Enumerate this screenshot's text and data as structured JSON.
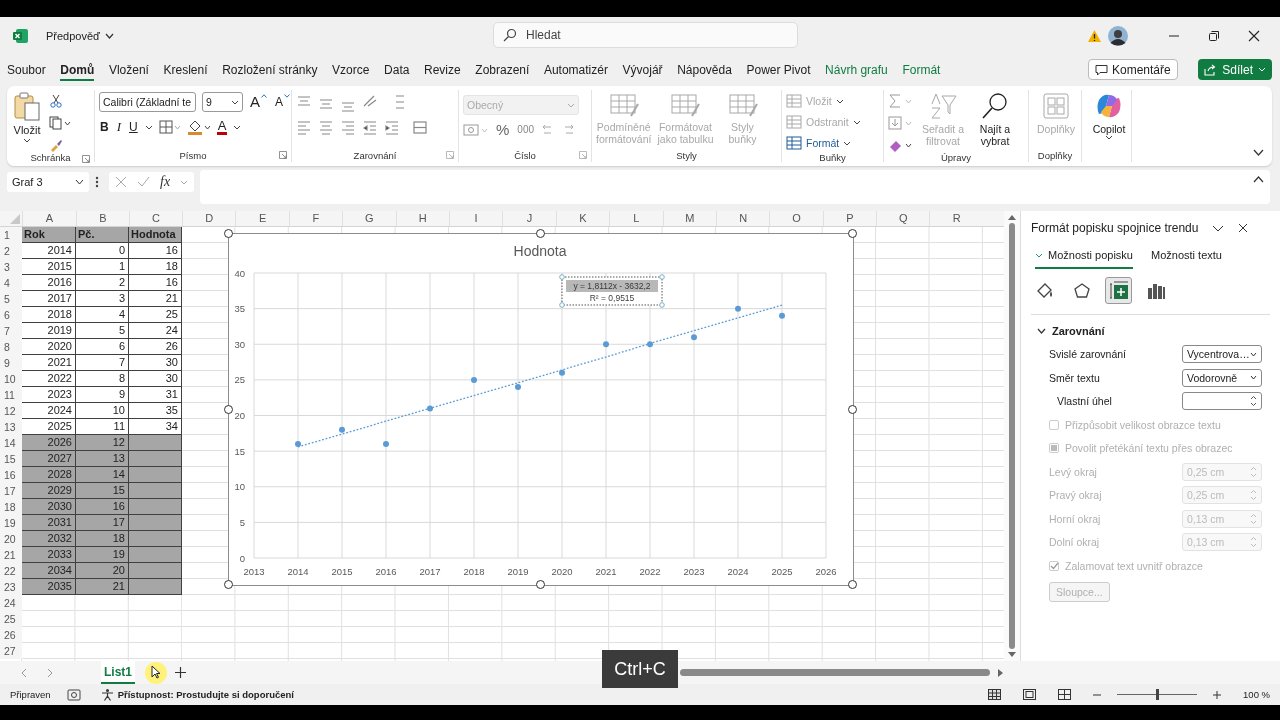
{
  "title_bar": {
    "file_name": "Předpověď",
    "search": {
      "placeholder": "Hledat"
    }
  },
  "menu_tabs": [
    {
      "label": "Soubor",
      "selected": false,
      "kind": "plain"
    },
    {
      "label": "Domů",
      "selected": true,
      "kind": "plain"
    },
    {
      "label": "Vložení",
      "selected": false,
      "kind": "plain"
    },
    {
      "label": "Kreslení",
      "selected": false,
      "kind": "plain"
    },
    {
      "label": "Rozložení stránky",
      "selected": false,
      "kind": "plain"
    },
    {
      "label": "Vzorce",
      "selected": false,
      "kind": "plain"
    },
    {
      "label": "Data",
      "selected": false,
      "kind": "plain"
    },
    {
      "label": "Revize",
      "selected": false,
      "kind": "plain"
    },
    {
      "label": "Zobrazení",
      "selected": false,
      "kind": "plain"
    },
    {
      "label": "Automatizér",
      "selected": false,
      "kind": "plain"
    },
    {
      "label": "Vývojář",
      "selected": false,
      "kind": "plain"
    },
    {
      "label": "Nápověda",
      "selected": false,
      "kind": "plain"
    },
    {
      "label": "Power Pivot",
      "selected": false,
      "kind": "plain"
    },
    {
      "label": "Návrh grafu",
      "selected": false,
      "kind": "context"
    },
    {
      "label": "Formát",
      "selected": false,
      "kind": "context"
    }
  ],
  "actions": {
    "comments": "Komentáře",
    "share": "Sdílet"
  },
  "ribbon": {
    "clipboard": {
      "label": "Schránka",
      "paste": "Vložit"
    },
    "font": {
      "label": "Písmo",
      "font": "Calibri (Základní te",
      "size": "9",
      "grow": "A",
      "shrink": "A",
      "bold": "B",
      "italic": "I",
      "underline": "U",
      "font_color_label": "A"
    },
    "alignment": {
      "label": "Zarovnání"
    },
    "number": {
      "label": "Číslo",
      "format": "Obecný",
      "percent": "%",
      "thousands": "000"
    },
    "styles": {
      "label": "Styly",
      "buttons": [
        {
          "lines": [
            "Podmíněné",
            "formátování"
          ],
          "disabled": true
        },
        {
          "lines": [
            "Formátovat",
            "jako tabulku"
          ],
          "disabled": true
        },
        {
          "lines": [
            "Styly",
            "buňky"
          ],
          "disabled": true
        }
      ]
    },
    "cells": {
      "label": "Buňky",
      "buttons": [
        {
          "label": "Vložit",
          "disabled": true
        },
        {
          "label": "Odstranit",
          "disabled": true
        },
        {
          "label": "Formát",
          "disabled": false
        }
      ]
    },
    "editing": {
      "label": "Úpravy",
      "sort": {
        "lines": [
          "Seřadit a",
          "filtrovat"
        ],
        "disabled": true
      },
      "find": {
        "lines": [
          "Najít a",
          "vybrat"
        ],
        "disabled": false
      }
    },
    "addins": {
      "label": "Doplňky",
      "button": {
        "label": "Doplňky",
        "disabled": true
      }
    },
    "copilot": {
      "label": "Copilot"
    }
  },
  "formula_bar": {
    "name_box": "Graf 3",
    "function_label": "fx"
  },
  "sheet": {
    "columns": [
      "A",
      "B",
      "C",
      "D",
      "E",
      "F",
      "G",
      "H",
      "I",
      "J",
      "K",
      "L",
      "M",
      "N",
      "O",
      "P",
      "Q",
      "R"
    ],
    "rows": [
      {
        "number": "1",
        "kind": "header",
        "cells": [
          "Rok",
          "Pč.",
          "Hodnota"
        ]
      },
      {
        "number": "2",
        "kind": "data",
        "cells": [
          "2014",
          "0",
          "16"
        ]
      },
      {
        "number": "3",
        "kind": "data",
        "cells": [
          "2015",
          "1",
          "18"
        ]
      },
      {
        "number": "4",
        "kind": "data",
        "cells": [
          "2016",
          "2",
          "16"
        ]
      },
      {
        "number": "5",
        "kind": "data",
        "cells": [
          "2017",
          "3",
          "21"
        ]
      },
      {
        "number": "6",
        "kind": "data",
        "cells": [
          "2018",
          "4",
          "25"
        ]
      },
      {
        "number": "7",
        "kind": "data",
        "cells": [
          "2019",
          "5",
          "24"
        ]
      },
      {
        "number": "8",
        "kind": "data",
        "cells": [
          "2020",
          "6",
          "26"
        ]
      },
      {
        "number": "9",
        "kind": "data",
        "cells": [
          "2021",
          "7",
          "30"
        ]
      },
      {
        "number": "10",
        "kind": "data",
        "cells": [
          "2022",
          "8",
          "30"
        ]
      },
      {
        "number": "11",
        "kind": "data",
        "cells": [
          "2023",
          "9",
          "31"
        ]
      },
      {
        "number": "12",
        "kind": "data",
        "cells": [
          "2024",
          "10",
          "35"
        ]
      },
      {
        "number": "13",
        "kind": "data",
        "cells": [
          "2025",
          "11",
          "34"
        ]
      },
      {
        "number": "14",
        "kind": "forecast",
        "cells": [
          "2026",
          "12"
        ]
      },
      {
        "number": "15",
        "kind": "forecast",
        "cells": [
          "2027",
          "13"
        ]
      },
      {
        "number": "16",
        "kind": "forecast",
        "cells": [
          "2028",
          "14"
        ]
      },
      {
        "number": "17",
        "kind": "forecast",
        "cells": [
          "2029",
          "15"
        ]
      },
      {
        "number": "18",
        "kind": "forecast",
        "cells": [
          "2030",
          "16"
        ]
      },
      {
        "number": "19",
        "kind": "forecast",
        "cells": [
          "2031",
          "17"
        ]
      },
      {
        "number": "20",
        "kind": "forecast",
        "cells": [
          "2032",
          "18"
        ]
      },
      {
        "number": "21",
        "kind": "forecast",
        "cells": [
          "2033",
          "19"
        ]
      },
      {
        "number": "22",
        "kind": "forecast",
        "cells": [
          "2034",
          "20"
        ]
      },
      {
        "number": "23",
        "kind": "forecast",
        "cells": [
          "2035",
          "21"
        ]
      },
      {
        "number": "24",
        "kind": "empty"
      },
      {
        "number": "25",
        "kind": "empty"
      },
      {
        "number": "26",
        "kind": "empty"
      },
      {
        "number": "27",
        "kind": "empty"
      }
    ]
  },
  "chart": {
    "chart_data": {
      "type": "scatter",
      "title": "Hodnota",
      "x": [
        2014,
        2015,
        2016,
        2017,
        2018,
        2019,
        2020,
        2021,
        2022,
        2023,
        2024,
        2025
      ],
      "series": [
        {
          "color": "#5b9bd5",
          "values": [
            16,
            18,
            16,
            21,
            25,
            24,
            26,
            30,
            30,
            31,
            35,
            34
          ]
        },
        {
          "type": "line",
          "line_style": "dotted",
          "color": "#5b9bd5",
          "values": [
            15.6,
            17.4,
            19.2,
            21.0,
            22.8,
            24.6,
            26.4,
            28.2,
            30.1,
            31.9,
            33.7,
            35.5
          ]
        }
      ],
      "xlim": [
        2013,
        2026
      ],
      "ylim": [
        0,
        40
      ],
      "xticks": [
        2013,
        2014,
        2015,
        2016,
        2017,
        2018,
        2019,
        2020,
        2021,
        2022,
        2023,
        2024,
        2025,
        2026
      ],
      "yticks": [
        0,
        5,
        10,
        15,
        20,
        25,
        30,
        35,
        40
      ],
      "grid": true,
      "annotations": [
        "y = 1,8112x - 3632,2",
        "R² = 0,9515"
      ]
    }
  },
  "pane": {
    "title": "Formát popisku spojnice trendu",
    "tabs": [
      {
        "label": "Možnosti popisku",
        "selected": true
      },
      {
        "label": "Možnosti textu",
        "selected": false
      }
    ],
    "icon_tabs": [
      {
        "kind": "fill",
        "selected": false
      },
      {
        "kind": "effects",
        "selected": false
      },
      {
        "kind": "size",
        "selected": true
      },
      {
        "kind": "chart",
        "selected": false
      }
    ],
    "section": {
      "label": "Zarovnání",
      "expanded": true
    },
    "fields": [
      {
        "kind": "select",
        "label": "Svislé zarovnání",
        "value": "Vycentrova…",
        "disabled": false
      },
      {
        "kind": "select",
        "label": "Směr textu",
        "value": "Vodorovně",
        "disabled": false
      },
      {
        "kind": "angle",
        "label": "Vlastní úhel",
        "disabled": false
      },
      {
        "kind": "checkbox",
        "label": "Přizpůsobit velikost obrazce textu",
        "checked": false,
        "indeterminate": false,
        "disabled": true
      },
      {
        "kind": "checkbox",
        "label": "Povolit přetékání textu přes obrazec",
        "checked": false,
        "indeterminate": true,
        "disabled": true
      },
      {
        "kind": "spin",
        "label": "Levý okraj",
        "value": "0,25 cm",
        "disabled": true
      },
      {
        "kind": "spin",
        "label": "Pravý okraj",
        "value": "0,25 cm",
        "disabled": true
      },
      {
        "kind": "spin",
        "label": "Horní okraj",
        "value": "0,13 cm",
        "disabled": true
      },
      {
        "kind": "spin",
        "label": "Dolní okraj",
        "value": "0,13 cm",
        "disabled": true
      },
      {
        "kind": "checkbox",
        "label": "Zalamovat text uvnitř obrazce",
        "checked": true,
        "indeterminate": false,
        "disabled": true
      }
    ],
    "columns_button": {
      "label": "Sloupce...",
      "disabled": true
    }
  },
  "sheet_tabs": [
    {
      "label": "List1",
      "selected": true
    }
  ],
  "key_hint": "Ctrl+C",
  "status_bar": {
    "ready": "Připraven",
    "accessibility": "Přístupnost: Prostudujte si doporučení",
    "zoom": {
      "label": "100 %",
      "level": 0.5
    }
  }
}
